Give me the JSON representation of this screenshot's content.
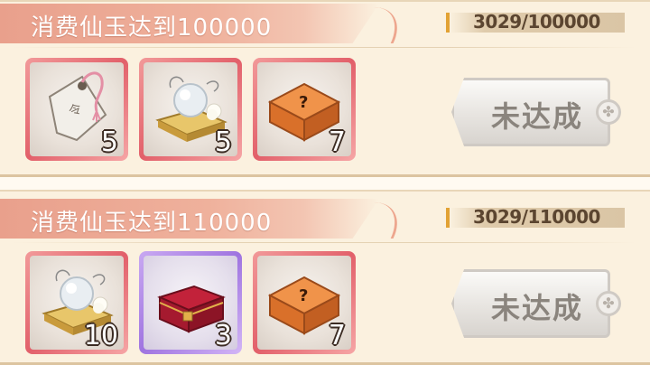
{
  "tiers": [
    {
      "title": "消费仙玉达到100000",
      "progress": "3029/100000",
      "status": "未达成",
      "rewards": [
        {
          "icon": "tag-talisman-icon",
          "count": "5",
          "frame": "red"
        },
        {
          "icon": "pearl-on-stand-icon",
          "count": "5",
          "frame": "red"
        },
        {
          "icon": "mystery-box-icon",
          "count": "7",
          "frame": "red"
        }
      ]
    },
    {
      "title": "消费仙玉达到110000",
      "progress": "3029/110000",
      "status": "未达成",
      "rewards": [
        {
          "icon": "pearl-on-stand-icon",
          "count": "10",
          "frame": "red"
        },
        {
          "icon": "treasure-chest-icon",
          "count": "3",
          "frame": "purple"
        },
        {
          "icon": "mystery-box-icon",
          "count": "7",
          "frame": "red"
        }
      ]
    }
  ],
  "colors": {
    "banner": "#e9a08c",
    "frame_red": "#e2606a",
    "frame_purple": "#9f74e0",
    "progress_accent": "#e2a234"
  }
}
